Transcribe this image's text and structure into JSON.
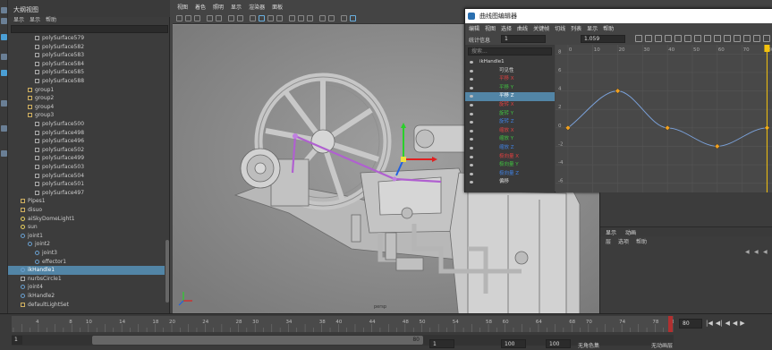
{
  "outliner": {
    "title": "大纲视图",
    "menu": [
      "显示",
      "显示",
      "帮助"
    ],
    "rows": [
      {
        "label": "polySurface579",
        "indent": 2,
        "kind": "mesh"
      },
      {
        "label": "polySurface582",
        "indent": 2,
        "kind": "mesh"
      },
      {
        "label": "polySurface583",
        "indent": 2,
        "kind": "mesh"
      },
      {
        "label": "polySurface584",
        "indent": 2,
        "kind": "mesh"
      },
      {
        "label": "polySurface585",
        "indent": 2,
        "kind": "mesh"
      },
      {
        "label": "polySurface588",
        "indent": 2,
        "kind": "mesh"
      },
      {
        "label": "group1",
        "indent": 1,
        "kind": "group"
      },
      {
        "label": "group2",
        "indent": 1,
        "kind": "group"
      },
      {
        "label": "group4",
        "indent": 1,
        "kind": "group"
      },
      {
        "label": "group3",
        "indent": 1,
        "kind": "group"
      },
      {
        "label": "polySurface500",
        "indent": 2,
        "kind": "mesh"
      },
      {
        "label": "polySurface498",
        "indent": 2,
        "kind": "mesh"
      },
      {
        "label": "polySurface496",
        "indent": 2,
        "kind": "mesh"
      },
      {
        "label": "polySurface502",
        "indent": 2,
        "kind": "mesh"
      },
      {
        "label": "polySurface499",
        "indent": 2,
        "kind": "mesh"
      },
      {
        "label": "polySurface503",
        "indent": 2,
        "kind": "mesh"
      },
      {
        "label": "polySurface504",
        "indent": 2,
        "kind": "mesh"
      },
      {
        "label": "polySurface501",
        "indent": 2,
        "kind": "mesh"
      },
      {
        "label": "polySurface497",
        "indent": 2,
        "kind": "mesh"
      },
      {
        "label": "Pipes1",
        "indent": 0,
        "kind": "group"
      },
      {
        "label": "disuo",
        "indent": 0,
        "kind": "group"
      },
      {
        "label": "aiSkyDomeLight1",
        "indent": 0,
        "kind": "light"
      },
      {
        "label": "sun",
        "indent": 0,
        "kind": "light"
      },
      {
        "label": "joint1",
        "indent": 0,
        "kind": "joint"
      },
      {
        "label": "joint2",
        "indent": 1,
        "kind": "joint"
      },
      {
        "label": "joint3",
        "indent": 2,
        "kind": "joint"
      },
      {
        "label": "effector1",
        "indent": 2,
        "kind": "joint"
      },
      {
        "label": "ikHandle1",
        "indent": 0,
        "kind": "joint",
        "selected": true
      },
      {
        "label": "nurbsCircle1",
        "indent": 0,
        "kind": "mesh"
      },
      {
        "label": "joint4",
        "indent": 0,
        "kind": "joint"
      },
      {
        "label": "ikHandle2",
        "indent": 0,
        "kind": "joint"
      },
      {
        "label": "defaultLightSet",
        "indent": 0,
        "kind": "group"
      }
    ]
  },
  "viewport": {
    "menu": [
      "视图",
      "着色",
      "照明",
      "显示",
      "渲染器",
      "面板"
    ],
    "camera_label": "persp"
  },
  "graph_editor": {
    "title": "曲线图编辑器",
    "menu": [
      "编辑",
      "视图",
      "选择",
      "曲线",
      "关键帧",
      "切线",
      "列表",
      "显示",
      "帮助"
    ],
    "stats_label": "统计信息",
    "field1": "1",
    "field2": "1.059",
    "search_placeholder": "搜索...",
    "channels": [
      {
        "label": "ikHandle1",
        "color": "#dddddd",
        "root": true
      },
      {
        "label": "可见性",
        "color": "#dddddd"
      },
      {
        "label": "平移 X",
        "color": "#e04040"
      },
      {
        "label": "平移 Y",
        "color": "#40c040"
      },
      {
        "label": "平移 Z",
        "color": "#ffffff",
        "selected": true
      },
      {
        "label": "旋转 X",
        "color": "#e04040"
      },
      {
        "label": "旋转 Y",
        "color": "#40c040"
      },
      {
        "label": "旋转 Z",
        "color": "#4080e0"
      },
      {
        "label": "缩放 X",
        "color": "#e04040"
      },
      {
        "label": "缩放 Y",
        "color": "#40c040"
      },
      {
        "label": "缩放 Z",
        "color": "#4080e0"
      },
      {
        "label": "极向量 X",
        "color": "#e04040"
      },
      {
        "label": "极向量 Y",
        "color": "#40c040"
      },
      {
        "label": "极向量 Z",
        "color": "#4080e0"
      },
      {
        "label": "偏移",
        "color": "#dddddd"
      }
    ],
    "graph": {
      "x_ticks": [
        "0",
        "10",
        "20",
        "30",
        "40",
        "50",
        "60",
        "70",
        "80"
      ],
      "y_ticks": [
        "8",
        "6",
        "4",
        "2",
        "0",
        "-2",
        "-4",
        "-6"
      ],
      "keys": [
        [
          0,
          0
        ],
        [
          20,
          4
        ],
        [
          40,
          0
        ],
        [
          60,
          -2
        ],
        [
          80,
          0
        ]
      ],
      "x_range": [
        -5,
        82
      ],
      "y_range": [
        -7,
        9
      ]
    }
  },
  "right_lower": {
    "tabs": [
      "显示",
      "动画"
    ],
    "menu": [
      "层",
      "选项",
      "帮助"
    ]
  },
  "timeline": {
    "ticks": [
      "4",
      "8",
      "10",
      "14",
      "18",
      "20",
      "24",
      "28",
      "30",
      "34",
      "38",
      "40",
      "44",
      "48",
      "50",
      "54",
      "58",
      "60",
      "64",
      "68",
      "70",
      "74",
      "78",
      "80"
    ],
    "current_frame": "80",
    "range_start_display": "1",
    "range_end_display": "80",
    "start_field": "1",
    "end_field": "100",
    "end_field2": "100",
    "fps_label": "无角色集",
    "anim_layer": "无动画层"
  },
  "colors": {
    "selection": "#5285a6",
    "accent": "#f4c20d"
  }
}
